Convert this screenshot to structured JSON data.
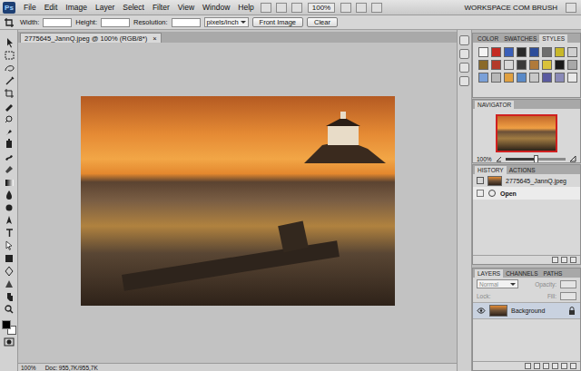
{
  "app": {
    "logo": "Ps",
    "menus": [
      "File",
      "Edit",
      "Image",
      "Layer",
      "Select",
      "Filter",
      "View",
      "Window",
      "Help"
    ],
    "zoom": "100%",
    "workspace": "WORKSPACE COM BRUSH"
  },
  "options_bar": {
    "width_label": "Width:",
    "height_label": "Height:",
    "resolution_label": "Resolution:",
    "units": "pixels/inch",
    "buttons": [
      "Front Image",
      "Clear"
    ]
  },
  "toolbar": {
    "foreground": "#000000",
    "background": "#ffffff"
  },
  "document": {
    "tab": "2775645_JannQ.jpeg @ 100% (RGB/8*)",
    "close": "×"
  },
  "styles_panel": {
    "tabs": [
      {
        "label": "COLOR",
        "selected": false
      },
      {
        "label": "SWATCHES",
        "selected": false
      },
      {
        "label": "STYLES",
        "selected": true
      }
    ],
    "styles": [
      {
        "color": "#f4f4f4"
      },
      {
        "color": "#c42a22"
      },
      {
        "color": "#3a5fb8"
      },
      {
        "color": "#2a2a2a"
      },
      {
        "color": "#2d4d9a"
      },
      {
        "color": "#6e6e6e"
      },
      {
        "color": "#c8b82a"
      },
      {
        "color": "#cfcfcf"
      },
      {
        "color": "#8a6a2a"
      },
      {
        "color": "#b33a2a"
      },
      {
        "color": "#d8d8d8"
      },
      {
        "color": "#3a3a3a"
      },
      {
        "color": "#b07a3a"
      },
      {
        "color": "#d9c23a"
      },
      {
        "color": "#1a1a1a"
      },
      {
        "color": "#a8a8a8"
      },
      {
        "color": "#7aa0d8"
      },
      {
        "color": "#b8b8b8"
      },
      {
        "color": "#e0a040"
      },
      {
        "color": "#5a8ac8"
      },
      {
        "color": "#c8c8c8"
      },
      {
        "color": "#5a5aa0"
      },
      {
        "color": "#8a8ab8"
      },
      {
        "color": "#e8e8e8"
      }
    ]
  },
  "navigator": {
    "title": "NAVIGATOR",
    "zoom": "100%",
    "level": 0.5
  },
  "history": {
    "tabs": [
      {
        "label": "HISTORY",
        "selected": true
      },
      {
        "label": "ACTIONS",
        "selected": false
      }
    ],
    "snapshot": "2775645_JannQ.jpeg",
    "steps": [
      {
        "label": "Open",
        "selected": true
      }
    ]
  },
  "layers": {
    "tabs": [
      {
        "label": "LAYERS",
        "selected": true
      },
      {
        "label": "CHANNELS",
        "selected": false
      },
      {
        "label": "PATHS",
        "selected": false
      }
    ],
    "blend_mode": "Normal",
    "opacity_label": "Opacity:",
    "lock_label": "Lock:",
    "fill_label": "Fill:",
    "items": [
      {
        "name": "Background",
        "visible": true,
        "locked": true,
        "selected": true
      }
    ]
  },
  "status_bar": {
    "zoom": "100%",
    "doc": "Doc: 955,7K/955,7K"
  }
}
